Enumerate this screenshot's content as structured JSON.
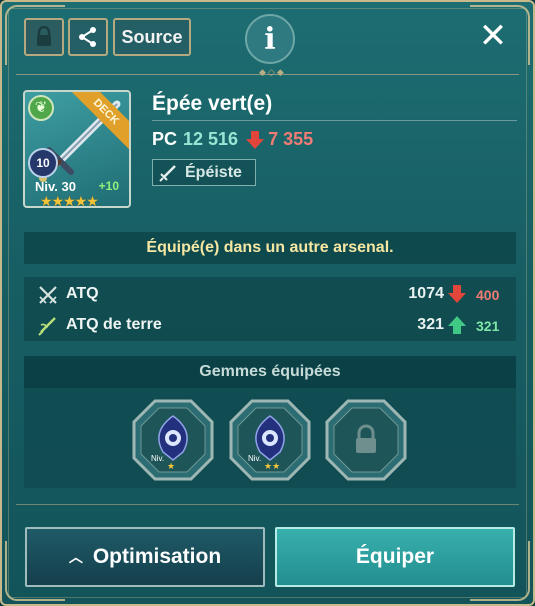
{
  "toolbar": {
    "source_label": "Source",
    "info_label": "i",
    "close_label": "✕"
  },
  "item": {
    "name": "Épée vert(e)",
    "deck_label": "DECK",
    "level_badge": "10",
    "level_label": "Niv. 30",
    "enhance_label": "+10",
    "stars": "★★★★★",
    "pc_label": "PC",
    "pc_value": "12 516",
    "pc_diff": "7 355",
    "class_label": "Épéiste"
  },
  "status": {
    "equipped_text": "Équipé(e) dans un autre arsenal."
  },
  "stats": [
    {
      "name": "ATQ",
      "value": "1074",
      "diff": "400",
      "direction": "down"
    },
    {
      "name": "ATQ de terre",
      "value": "321",
      "diff": "321",
      "direction": "up"
    }
  ],
  "gems": {
    "header": "Gemmes équipées",
    "slots": [
      {
        "niv_label": "Niv.",
        "stars": "★",
        "state": "filled"
      },
      {
        "niv_label": "Niv.",
        "stars": "★★",
        "state": "filled"
      },
      {
        "state": "locked"
      }
    ]
  },
  "actions": {
    "optimise_label": "Optimisation",
    "equip_label": "Équiper"
  },
  "colors": {
    "panel": "#1a6a70",
    "accent_gold": "#c8b98a",
    "diff_down": "#f07c74",
    "diff_up": "#7ee7a7",
    "notice": "#f6e7a2"
  }
}
